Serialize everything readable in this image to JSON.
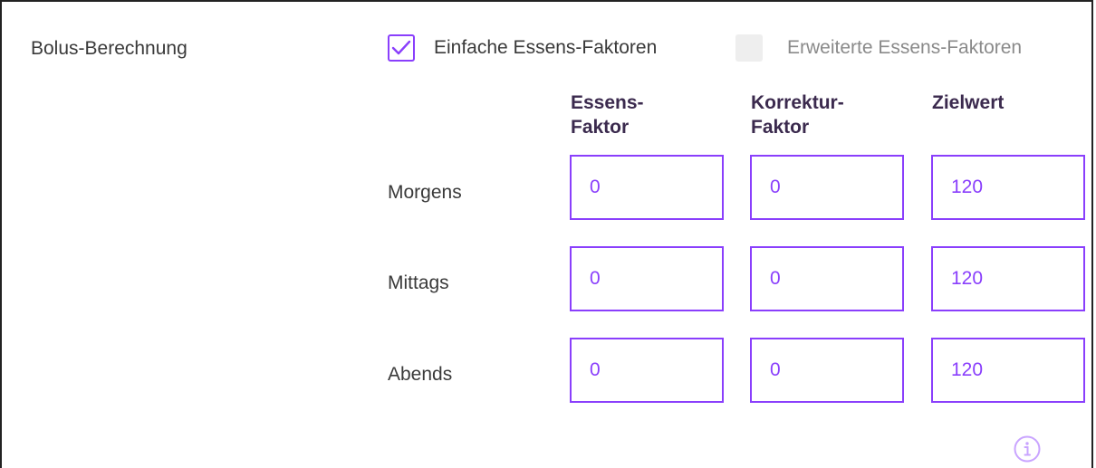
{
  "section": {
    "label": "Bolus-Berechnung"
  },
  "options": {
    "simple": {
      "label": "Einfache Essens-Faktoren",
      "checked": true
    },
    "advanced": {
      "label": "Erweiterte Essens-Faktoren",
      "checked": false
    }
  },
  "columns": {
    "essens": {
      "line1": "Essens-",
      "line2": "Faktor"
    },
    "korrektur": {
      "line1": "Korrektur-",
      "line2": "Faktor"
    },
    "zielwert": {
      "line1": "Zielwert"
    }
  },
  "rows": [
    {
      "label": "Morgens",
      "essens": "0",
      "korrektur": "0",
      "zielwert": "120"
    },
    {
      "label": "Mittags",
      "essens": "0",
      "korrektur": "0",
      "zielwert": "120"
    },
    {
      "label": "Abends",
      "essens": "0",
      "korrektur": "0",
      "zielwert": "120"
    }
  ],
  "icons": {
    "info": "info-circle-icon",
    "check": "checkmark-icon"
  },
  "colors": {
    "accent": "#8a3ffc",
    "heading": "#3b2a4e",
    "text": "#3a3a3a",
    "muted": "#8a8a8a"
  }
}
